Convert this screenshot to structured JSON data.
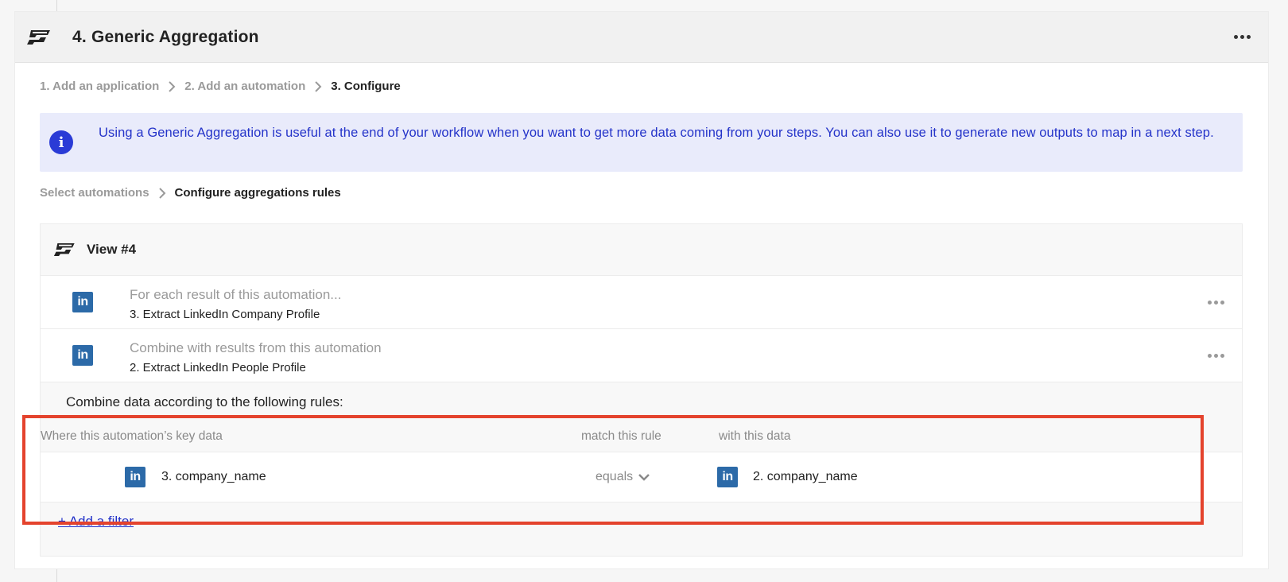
{
  "card": {
    "title": "4. Generic Aggregation",
    "logo_icon": "captain-data-logo-icon",
    "menu_icon": "more-horizontal-icon"
  },
  "breadcrumb": [
    {
      "label": "1. Add an application",
      "active": false
    },
    {
      "label": "2. Add an automation",
      "active": false
    },
    {
      "label": "3. Configure",
      "active": true
    }
  ],
  "info": {
    "icon": "info-icon",
    "icon_glyph": "i",
    "text": "Using a Generic Aggregation is useful at the end of your workflow when you want to get more data coming from your steps. You can also use it to generate new outputs to map in a next step."
  },
  "substeps": [
    {
      "label": "Select automations",
      "active": false
    },
    {
      "label": "Configure aggregations rules",
      "active": true
    }
  ],
  "view": {
    "title": "View #4",
    "automations": [
      {
        "icon": "linkedin-icon",
        "icon_glyph": "in",
        "subtitle": "For each result of this automation...",
        "name": "3. Extract LinkedIn Company Profile"
      },
      {
        "icon": "linkedin-icon",
        "icon_glyph": "in",
        "subtitle": "Combine with results from this automation",
        "name": "2. Extract LinkedIn People Profile"
      }
    ],
    "rules_label": "Combine data according to the following rules:",
    "rules_headers": {
      "key": "Where this automation’s key data",
      "rule": "match this rule",
      "data": "with this data"
    },
    "rule": {
      "key_a": "3. company_name",
      "operator": "equals",
      "key_b": "2. company_name"
    },
    "add_filter": "+ Add a filter"
  },
  "colors": {
    "accent": "#2433c9",
    "info_bg": "#e9ebfb",
    "linkedin": "#2c6aa8",
    "highlight": "#e4432d"
  }
}
